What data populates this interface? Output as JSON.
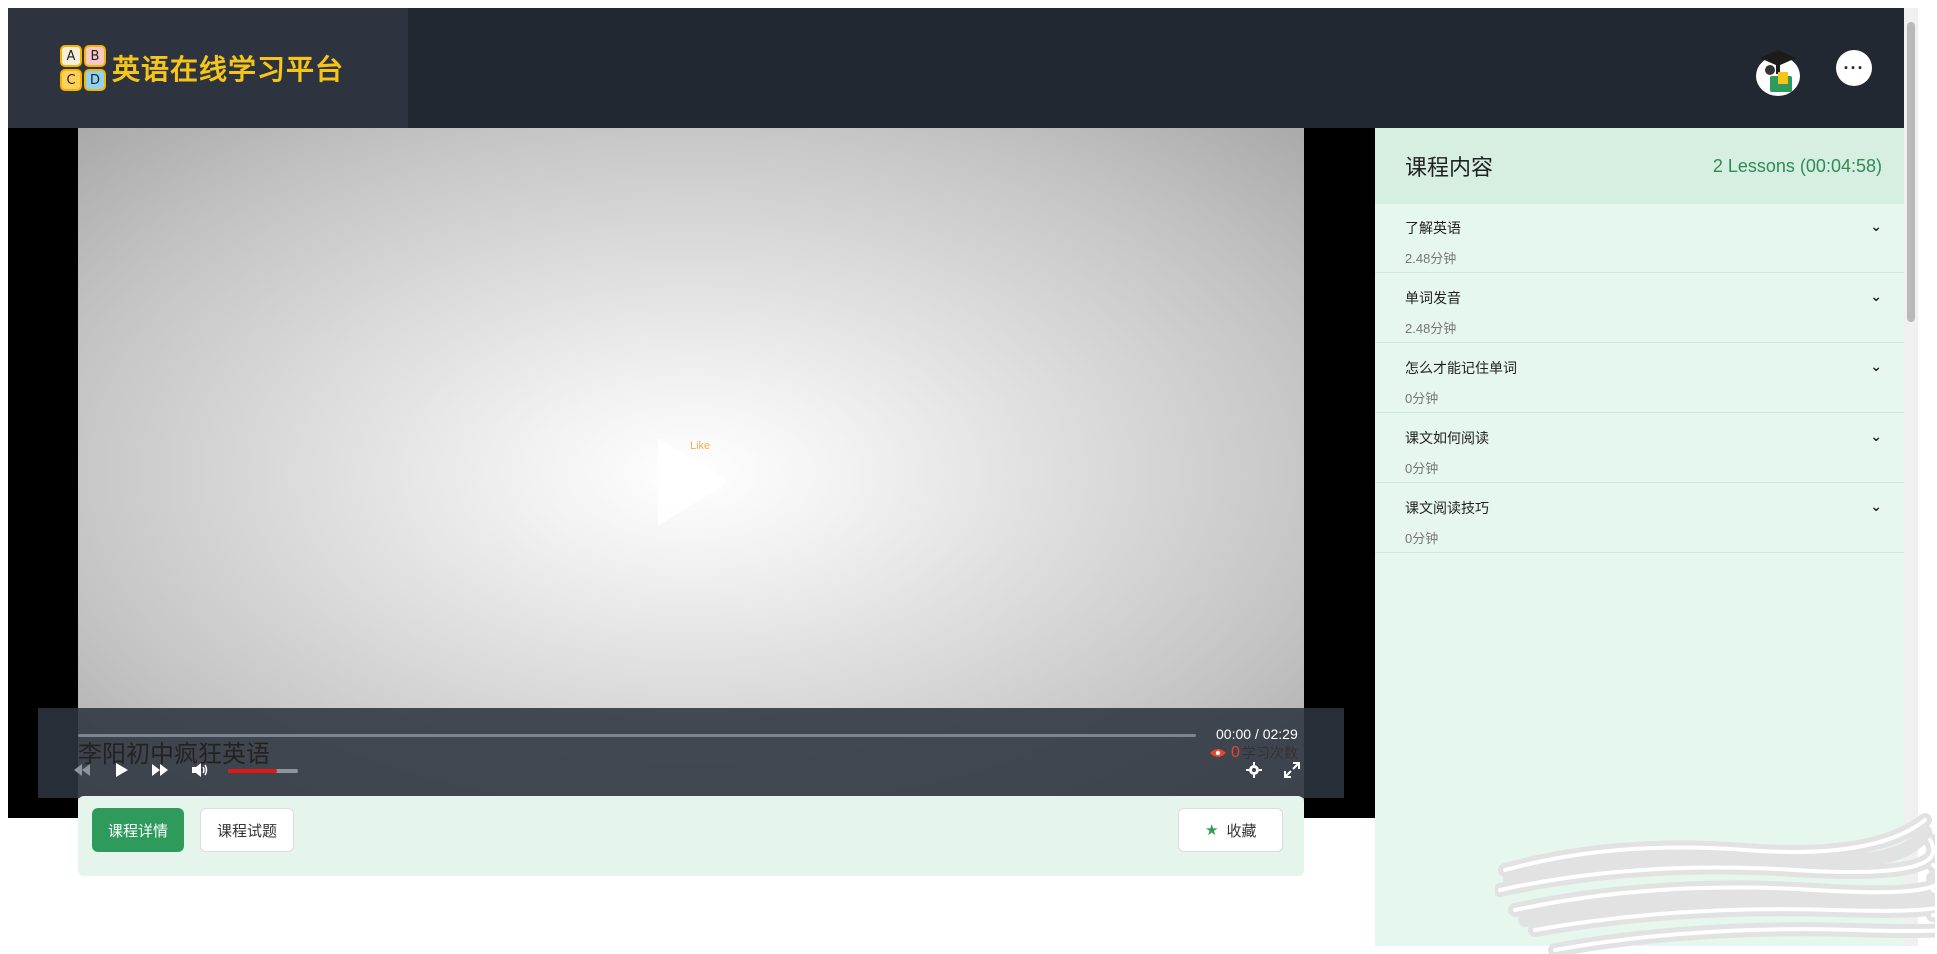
{
  "header": {
    "brand_letters": [
      "A",
      "B",
      "C",
      "D"
    ],
    "brand_title": "英语在线学习平台",
    "more_label": "···"
  },
  "video": {
    "overlay_text": "Like",
    "time": "00:00 / 02:29",
    "progress_fraction": 0,
    "volume_fraction": 0.7
  },
  "course": {
    "title": "李阳初中疯狂英语",
    "views_count": "0",
    "views_label": "学习次数",
    "tabs": [
      "课程详情",
      "课程试题"
    ],
    "favorite_label": "收藏"
  },
  "sidebar": {
    "title": "课程内容",
    "meta": "2 Lessons (00:04:58)",
    "lessons": [
      {
        "name": "了解英语",
        "duration": "2.48分钟"
      },
      {
        "name": "单词发音",
        "duration": "2.48分钟"
      },
      {
        "name": "怎么才能记住单词",
        "duration": "0分钟"
      },
      {
        "name": "课文如何阅读",
        "duration": "0分钟"
      },
      {
        "name": "课文阅读技巧",
        "duration": "0分钟"
      }
    ]
  },
  "colors": {
    "header_bg": "#222831",
    "accent_green": "#2e9a5b",
    "brand_yellow": "#f5c518",
    "volume_red": "#e01717"
  }
}
